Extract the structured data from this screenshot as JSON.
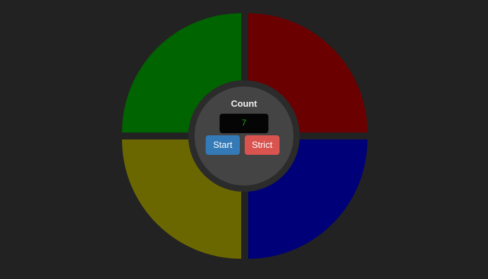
{
  "colors": {
    "background": "#222222",
    "green_pad": "#006400",
    "red_pad": "#6b0000",
    "yellow_pad": "#6b6700",
    "blue_pad": "#000078",
    "hub": "#444444",
    "start_button": "#337ab7",
    "strict_button": "#d9534f"
  },
  "pads": {
    "green": "green",
    "red": "red",
    "yellow": "yellow",
    "blue": "blue"
  },
  "controls": {
    "title": "Count",
    "count_value": "7",
    "start_label": "Start",
    "strict_label": "Strict"
  }
}
